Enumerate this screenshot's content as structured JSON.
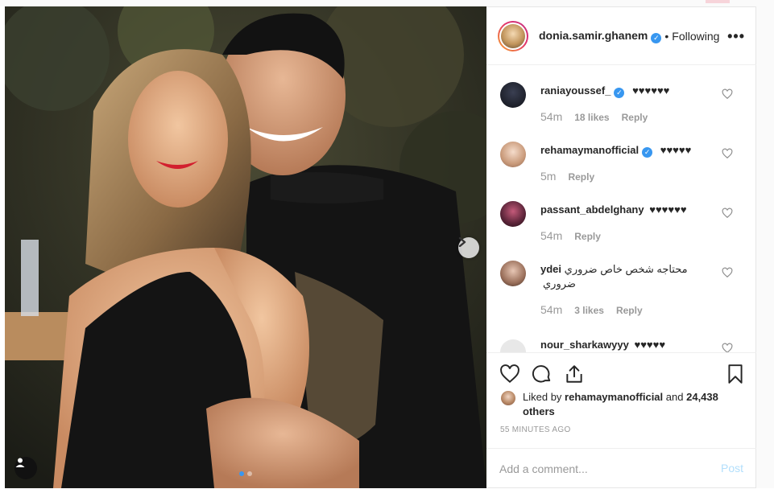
{
  "post": {
    "username": "donia.samir.ghanem",
    "dot": "•",
    "follow_status": "Following",
    "more": "•••"
  },
  "comments": [
    {
      "user": "raniayoussef_",
      "verified": true,
      "text": "♥♥♥♥♥♥",
      "time": "54m",
      "likes": "18 likes",
      "reply": "Reply"
    },
    {
      "user": "rehamaymanofficial",
      "verified": true,
      "text": "♥♥♥♥♥",
      "time": "5m",
      "likes": "",
      "reply": "Reply"
    },
    {
      "user": "passant_abdelghany",
      "verified": false,
      "text": "♥♥♥♥♥♥",
      "time": "54m",
      "likes": "",
      "reply": "Reply"
    },
    {
      "user": "ydei",
      "verified": false,
      "text": "محتاجه شخص خاص ضروري ضروري",
      "time": "54m",
      "likes": "3 likes",
      "reply": "Reply"
    },
    {
      "user": "nour_sharkawyyy",
      "verified": false,
      "text": "♥♥♥♥♥",
      "time": "",
      "likes": "",
      "reply": ""
    }
  ],
  "likes": {
    "prefix": "Liked by",
    "user": "rehamaymanofficial",
    "and": "and",
    "others": "24,438 others"
  },
  "timestamp": "55 MINUTES AGO",
  "add_comment": {
    "placeholder": "Add a comment...",
    "post_label": "Post"
  },
  "colors": {
    "verified": "#3897f0",
    "post_disabled": "#b2dffc",
    "muted": "#999999"
  },
  "icons": [
    "heart-icon",
    "comment-icon",
    "share-icon",
    "bookmark-icon",
    "next-arrow-icon",
    "user-tag-icon",
    "more-icon"
  ]
}
